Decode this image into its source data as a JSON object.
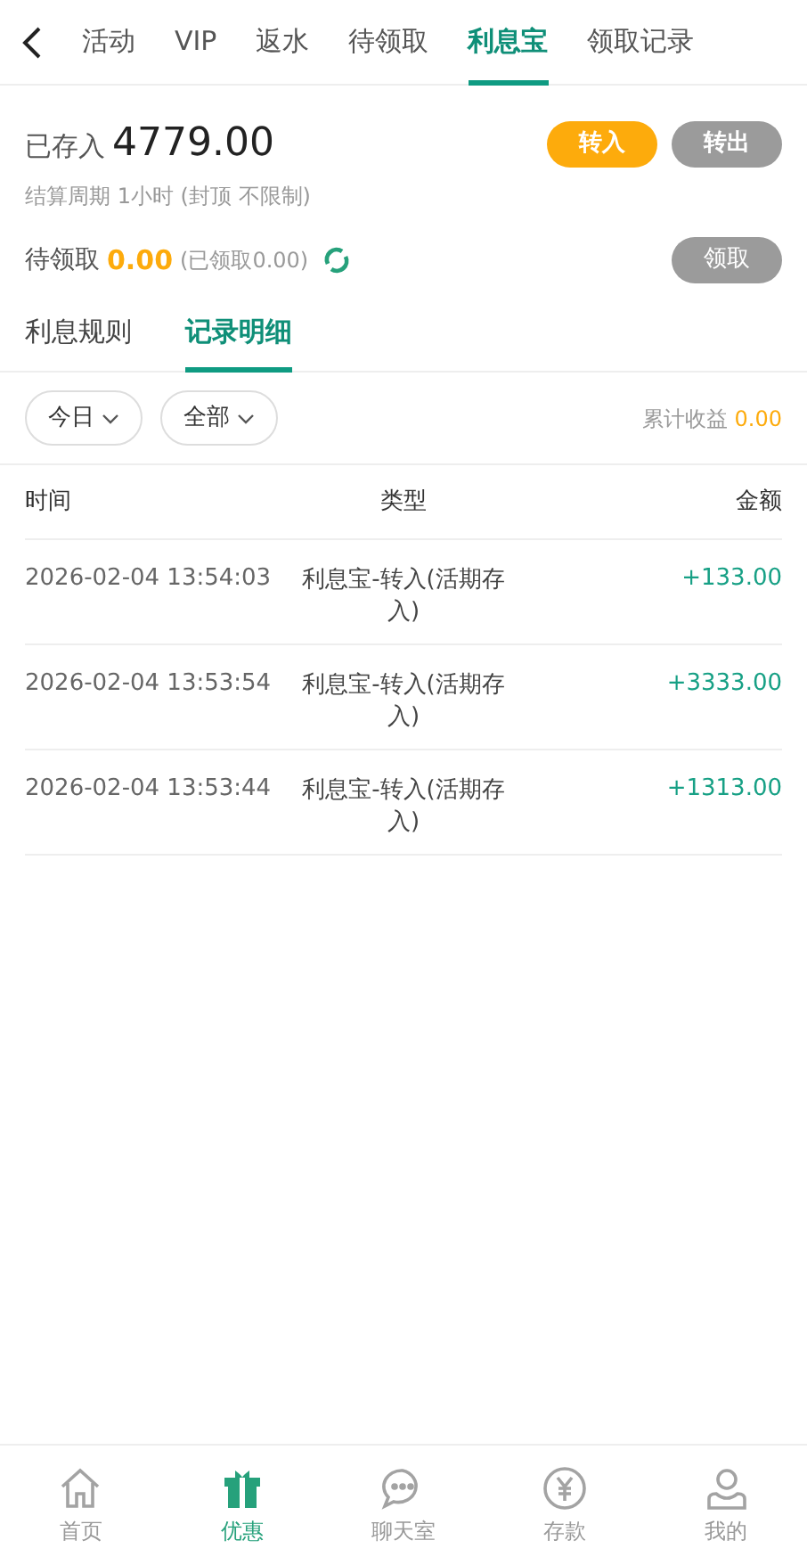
{
  "top_tabs": [
    {
      "label": "活动",
      "selected": false
    },
    {
      "label": "VIP",
      "selected": false
    },
    {
      "label": "返水",
      "selected": false
    },
    {
      "label": "待领取",
      "selected": false
    },
    {
      "label": "利息宝",
      "selected": true
    },
    {
      "label": "领取记录",
      "selected": false
    }
  ],
  "summary": {
    "deposited_label": "已存入",
    "deposited_amount": "4779.00",
    "transfer_in": "转入",
    "transfer_out": "转出",
    "cycle_note": "结算周期 1小时 (封顶 不限制)",
    "pending_label": "待领取",
    "pending_amount": "0.00",
    "claimed_note": "(已领取0.00)",
    "claim_button": "领取"
  },
  "sub_tabs": [
    {
      "label": "利息规则",
      "selected": false
    },
    {
      "label": "记录明细",
      "selected": true
    }
  ],
  "filters": [
    {
      "label": "今日"
    },
    {
      "label": "全部"
    }
  ],
  "total": {
    "label": "累计收益",
    "value": "0.00"
  },
  "table": {
    "columns": [
      "时间",
      "类型",
      "金额"
    ],
    "rows": [
      {
        "time": "2026-02-04 13:54:03",
        "type": "利息宝-转入(活期存入)",
        "amount": "+133.00"
      },
      {
        "time": "2026-02-04 13:53:54",
        "type": "利息宝-转入(活期存入)",
        "amount": "+3333.00"
      },
      {
        "time": "2026-02-04 13:53:44",
        "type": "利息宝-转入(活期存入)",
        "amount": "+1313.00"
      }
    ]
  },
  "bottom_nav": [
    {
      "kind": "home",
      "label": "首页",
      "selected": false
    },
    {
      "kind": "gift",
      "label": "优惠",
      "selected": true
    },
    {
      "kind": "chat",
      "label": "聊天室",
      "selected": false
    },
    {
      "kind": "yen",
      "label": "存款",
      "selected": false
    },
    {
      "kind": "user",
      "label": "我的",
      "selected": false
    }
  ]
}
